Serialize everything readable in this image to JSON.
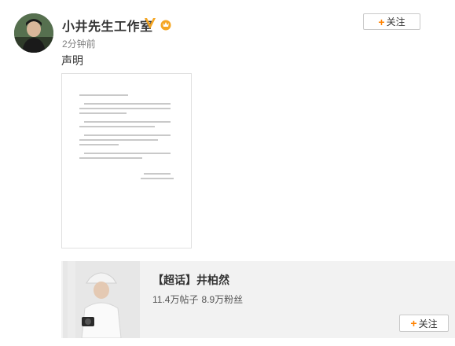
{
  "header": {
    "user_name": "小井先生工作室",
    "time": "2分钟前",
    "follow_label": "关注",
    "follow_plus": "+"
  },
  "post": {
    "text": "声明"
  },
  "topic_card": {
    "title": "【超话】井柏然",
    "posts": "11.4万帖子",
    "fans": "8.9万粉丝",
    "follow_label": "关注",
    "follow_plus": "+"
  },
  "colors": {
    "accent": "#ff8200",
    "verified_badge": "#f5a623",
    "card_bg": "#f2f2f2"
  }
}
